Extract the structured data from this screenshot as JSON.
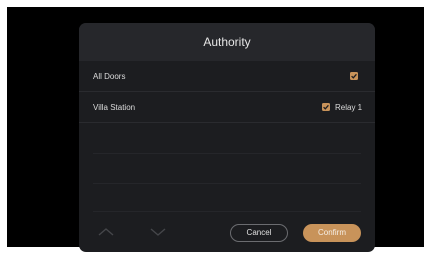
{
  "dialog": {
    "title": "Authority",
    "rows": [
      {
        "label": "All Doors",
        "checked": true
      },
      {
        "label": "Villa Station",
        "checked": true,
        "option_label": "Relay 1"
      }
    ],
    "buttons": {
      "cancel": "Cancel",
      "confirm": "Confirm"
    }
  },
  "colors": {
    "accent": "#c8935a",
    "dialog_bg": "#1c1d20",
    "header_bg": "#26272b"
  },
  "icons": {
    "up": "chevron-up-icon",
    "down": "chevron-down-icon",
    "check": "check-icon"
  }
}
